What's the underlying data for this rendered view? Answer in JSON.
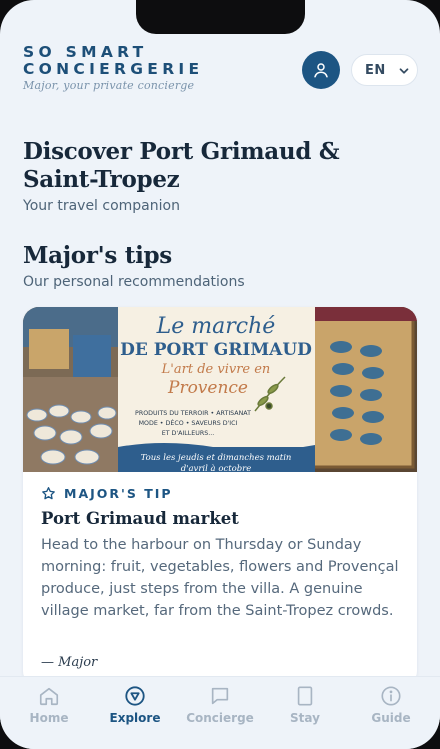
{
  "header": {
    "brand_line1": "SO SMART",
    "brand_line2": "CONCIERGERIE",
    "tagline": "Major, your private concierge",
    "language": "EN"
  },
  "hero": {
    "title": "Discover Port Grimaud & Saint-Tropez",
    "subtitle": "Your travel companion"
  },
  "tips_section": {
    "title": "Major's tips",
    "subtitle": "Our personal recommendations"
  },
  "card": {
    "image": {
      "line1": "Le marché",
      "line2": "DE PORT GRIMAUD",
      "line3": "L'art de vivre en",
      "line4": "Provence",
      "products1": "PRODUITS DU TERROIR • ARTISANAT",
      "products2": "MODE • DÉCO • SAVEURS D'ICI",
      "products3": "ET D'AILLEURS...",
      "days1": "Tous les jeudis et dimanches matin",
      "days2": "d'avril à octobre"
    },
    "badge": "MAJOR'S TIP",
    "title": "Port Grimaud market",
    "body": "Head to the harbour on Thursday or Sunday morning: fruit, vegetables, flowers and Provençal produce, just steps from the villa. A genuine village market, far from the Saint-Tropez crowds.",
    "signature": "— Major"
  },
  "nav": {
    "items": [
      {
        "label": "Home",
        "icon": "home-icon"
      },
      {
        "label": "Explore",
        "icon": "compass-icon",
        "active": true
      },
      {
        "label": "Concierge",
        "icon": "chat-icon"
      },
      {
        "label": "Stay",
        "icon": "phone-icon"
      },
      {
        "label": "Guide",
        "icon": "info-icon"
      }
    ]
  },
  "colors": {
    "primary": "#1d5583",
    "background": "#eef3f9",
    "text": "#17283a",
    "muted": "#a8b5c3"
  }
}
